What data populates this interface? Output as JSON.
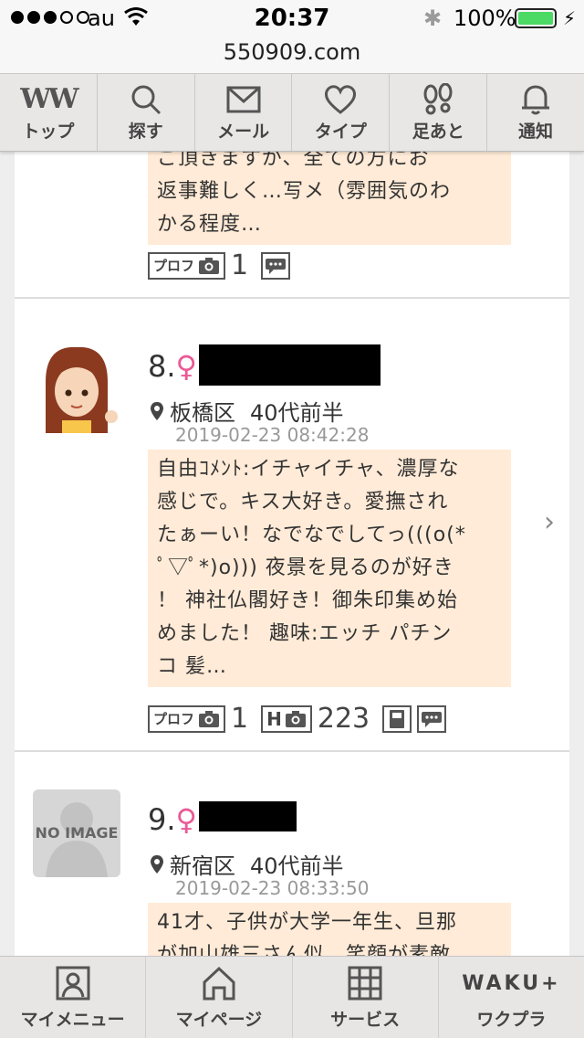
{
  "status": {
    "carrier": "au",
    "time": "20:37",
    "battery": "100%"
  },
  "url": "550909.com",
  "topnav": [
    {
      "label": "トップ",
      "logo": "WW",
      "icon": "ww-logo-icon"
    },
    {
      "label": "探す",
      "icon": "search-icon"
    },
    {
      "label": "メール",
      "icon": "mail-icon"
    },
    {
      "label": "タイプ",
      "icon": "heart-icon"
    },
    {
      "label": "足あと",
      "icon": "footprint-icon"
    },
    {
      "label": "通知",
      "icon": "bell-icon"
    }
  ],
  "posts": [
    {
      "comment_lines": [
        "ご頂きますが、全ての方にお",
        "返事難しく…写メ（雰囲気のわ",
        "かる程度…"
      ],
      "prof_label": "プロフ",
      "photo_count": "1"
    },
    {
      "number": "8.",
      "gender": "♀",
      "location": "板橋区",
      "age": "40代前半",
      "date": "2019-02-23 08:42:28",
      "comment_lines": [
        "自由ｺﾒﾝﾄ:イチャイチャ、濃厚な",
        "感じで。キス大好き。愛撫され",
        "たぁーい！なでなでしてっ(((o(*",
        "ﾟ▽ﾟ*)o))) 夜景を見るのが好き",
        "！ 神社仏閣好き！御朱印集め始",
        "めました！ 趣味:エッチ パチン",
        "コ 髪…"
      ],
      "prof_label": "プロフ",
      "photo_count": "1",
      "h_label": "H",
      "h_count": "223"
    },
    {
      "number": "9.",
      "gender": "♀",
      "location": "新宿区",
      "age": "40代前半",
      "date": "2019-02-23 08:33:50",
      "no_image": "NO IMAGE",
      "comment_lines": [
        "41才、子供が大学一年生、旦那",
        "が加山雄三さん似、笑顔が素敵"
      ]
    }
  ],
  "bottomnav": [
    {
      "label": "マイメニュー",
      "icon": "person-icon"
    },
    {
      "label": "マイページ",
      "icon": "home-icon"
    },
    {
      "label": "サービス",
      "icon": "grid-icon"
    },
    {
      "label": "ワクプラ",
      "logo": "WAKU+"
    }
  ],
  "colors": {
    "accent_pink": "#ea5a96",
    "comment_bg": "#ffebd7",
    "battery_green": "#4cd964"
  }
}
